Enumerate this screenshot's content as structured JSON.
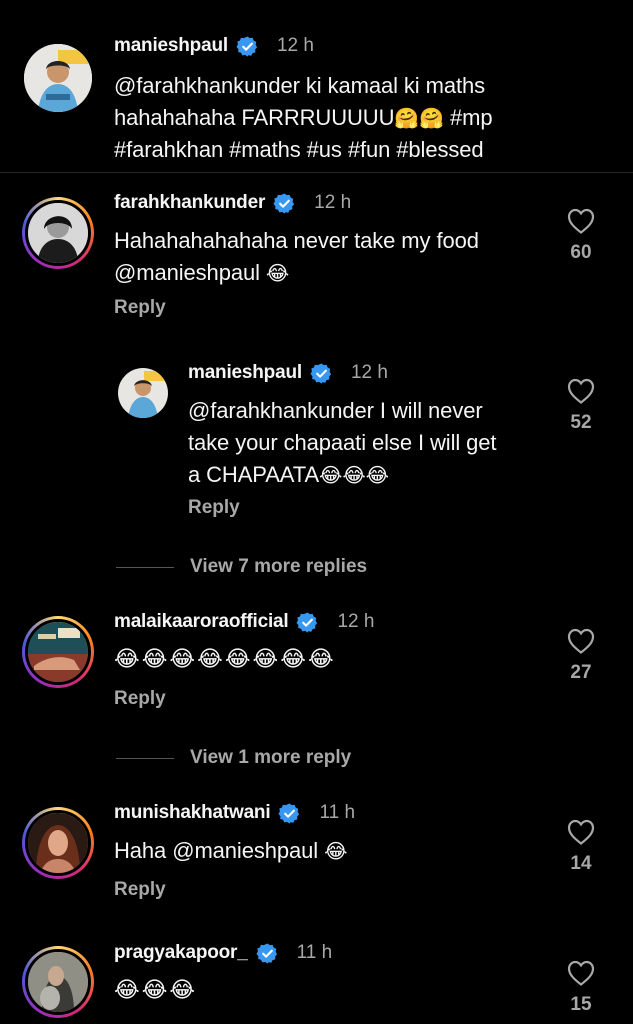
{
  "comments": {
    "caption": {
      "username": "manieshpaul",
      "time": "12 h",
      "line1": "@farahkhankunder ki kamaal ki maths",
      "line2": "hahahahaha FARRRUUUUU",
      "line2_emoji": "🤗🤗",
      "line2_tail": " #mp",
      "line3": "#farahkhan #maths #us #fun #blessed"
    },
    "c1": {
      "username": "farahkhankunder",
      "time": "12 h",
      "line1": "Hahahahahahaha never take my food",
      "line2": "@manieshpaul",
      "line2_emoji": "😂",
      "reply": "Reply",
      "likes": "60"
    },
    "r1": {
      "username": "manieshpaul",
      "time": "12 h",
      "line1": "@farahkhankunder I will never",
      "line2": "take your chapaati else I will get",
      "line3": "a CHAPAATA",
      "line3_emoji": "😂😂😂",
      "reply": "Reply",
      "likes": "52"
    },
    "view_more_1": "View 7 more replies",
    "c2": {
      "username": "malaikaaroraofficial",
      "time": "12 h",
      "emoji": "😂😂😂😂😂😂😂😂",
      "reply": "Reply",
      "likes": "27"
    },
    "view_more_2": "View 1 more reply",
    "c3": {
      "username": "munishakhatwani",
      "time": "11 h",
      "line1": "Haha @manieshpaul",
      "line1_emoji": "😂",
      "reply": "Reply",
      "likes": "14"
    },
    "c4": {
      "username": "pragyakapoor_",
      "time": "11 h",
      "emoji": "😂😂😂",
      "likes": "15"
    }
  },
  "colors": {
    "background": "#000000",
    "verified": "#3897f0",
    "muted": "#a8a8a8"
  },
  "icons": [
    "verified-badge-icon",
    "heart-outline-icon"
  ]
}
